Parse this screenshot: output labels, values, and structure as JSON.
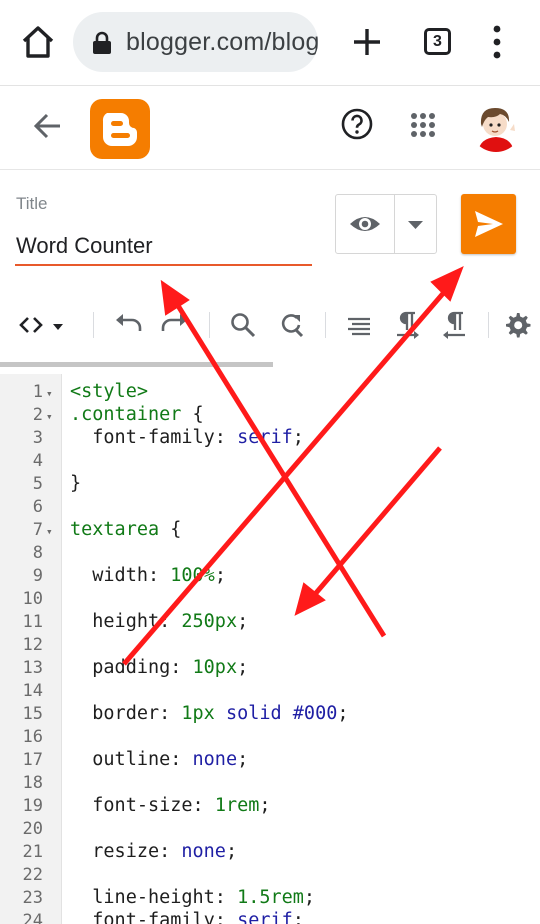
{
  "browser": {
    "url": "blogger.com/blog/post/edit",
    "tab_count": "3"
  },
  "app": {
    "name": "Blogger"
  },
  "title_field": {
    "label": "Title",
    "value": "Word Counter"
  },
  "toolbar": {
    "items": [
      "code-view",
      "undo",
      "redo",
      "find",
      "replace",
      "format",
      "ltr",
      "rtl",
      "settings"
    ]
  },
  "editor": {
    "lines": [
      {
        "n": "1",
        "fold": true,
        "tokens": [
          [
            "t-tag",
            "<style>"
          ]
        ]
      },
      {
        "n": "2",
        "fold": true,
        "tokens": [
          [
            "t-sel",
            ".container"
          ],
          [
            "t-pun",
            " {"
          ]
        ]
      },
      {
        "n": "3",
        "fold": false,
        "tokens": [
          [
            "t-prop",
            "  font-family"
          ],
          [
            "t-pun",
            ": "
          ],
          [
            "t-kw",
            "serif"
          ],
          [
            "t-pun",
            ";"
          ]
        ]
      },
      {
        "n": "4",
        "fold": false,
        "tokens": []
      },
      {
        "n": "5",
        "fold": false,
        "tokens": [
          [
            "t-pun",
            "}"
          ]
        ]
      },
      {
        "n": "6",
        "fold": false,
        "tokens": []
      },
      {
        "n": "7",
        "fold": true,
        "tokens": [
          [
            "t-sel",
            "textarea"
          ],
          [
            "t-pun",
            " {"
          ]
        ]
      },
      {
        "n": "8",
        "fold": false,
        "tokens": []
      },
      {
        "n": "9",
        "fold": false,
        "tokens": [
          [
            "t-prop",
            "  width"
          ],
          [
            "t-pun",
            ": "
          ],
          [
            "t-num",
            "100%"
          ],
          [
            "t-pun",
            ";"
          ]
        ]
      },
      {
        "n": "10",
        "fold": false,
        "tokens": []
      },
      {
        "n": "11",
        "fold": false,
        "tokens": [
          [
            "t-prop",
            "  height"
          ],
          [
            "t-pun",
            ": "
          ],
          [
            "t-num",
            "250px"
          ],
          [
            "t-pun",
            ";"
          ]
        ]
      },
      {
        "n": "12",
        "fold": false,
        "tokens": []
      },
      {
        "n": "13",
        "fold": false,
        "tokens": [
          [
            "t-prop",
            "  padding"
          ],
          [
            "t-pun",
            ": "
          ],
          [
            "t-num",
            "10px"
          ],
          [
            "t-pun",
            ";"
          ]
        ]
      },
      {
        "n": "14",
        "fold": false,
        "tokens": []
      },
      {
        "n": "15",
        "fold": false,
        "tokens": [
          [
            "t-prop",
            "  border"
          ],
          [
            "t-pun",
            ": "
          ],
          [
            "t-num",
            "1px"
          ],
          [
            "t-pun",
            " "
          ],
          [
            "t-atom",
            "solid"
          ],
          [
            "t-pun",
            " "
          ],
          [
            "t-kw",
            "#000"
          ],
          [
            "t-pun",
            ";"
          ]
        ]
      },
      {
        "n": "16",
        "fold": false,
        "tokens": []
      },
      {
        "n": "17",
        "fold": false,
        "tokens": [
          [
            "t-prop",
            "  outline"
          ],
          [
            "t-pun",
            ": "
          ],
          [
            "t-atom",
            "none"
          ],
          [
            "t-pun",
            ";"
          ]
        ]
      },
      {
        "n": "18",
        "fold": false,
        "tokens": []
      },
      {
        "n": "19",
        "fold": false,
        "tokens": [
          [
            "t-prop",
            "  font-size"
          ],
          [
            "t-pun",
            ": "
          ],
          [
            "t-num",
            "1rem"
          ],
          [
            "t-pun",
            ";"
          ]
        ]
      },
      {
        "n": "20",
        "fold": false,
        "tokens": []
      },
      {
        "n": "21",
        "fold": false,
        "tokens": [
          [
            "t-prop",
            "  resize"
          ],
          [
            "t-pun",
            ": "
          ],
          [
            "t-atom",
            "none"
          ],
          [
            "t-pun",
            ";"
          ]
        ]
      },
      {
        "n": "22",
        "fold": false,
        "tokens": []
      },
      {
        "n": "23",
        "fold": false,
        "tokens": [
          [
            "t-prop",
            "  line-height"
          ],
          [
            "t-pun",
            ": "
          ],
          [
            "t-num",
            "1.5rem"
          ],
          [
            "t-pun",
            ";"
          ]
        ]
      },
      {
        "n": "24",
        "fold": false,
        "tokens": [
          [
            "t-prop",
            "  font-family"
          ],
          [
            "t-pun",
            ": "
          ],
          [
            "t-kw",
            "serif"
          ],
          [
            "t-pun",
            ";"
          ]
        ]
      }
    ]
  },
  "colors": {
    "blogger_orange": "#f57d00",
    "title_underline": "#e8592b",
    "annotation_red": "#ff1a1a"
  }
}
